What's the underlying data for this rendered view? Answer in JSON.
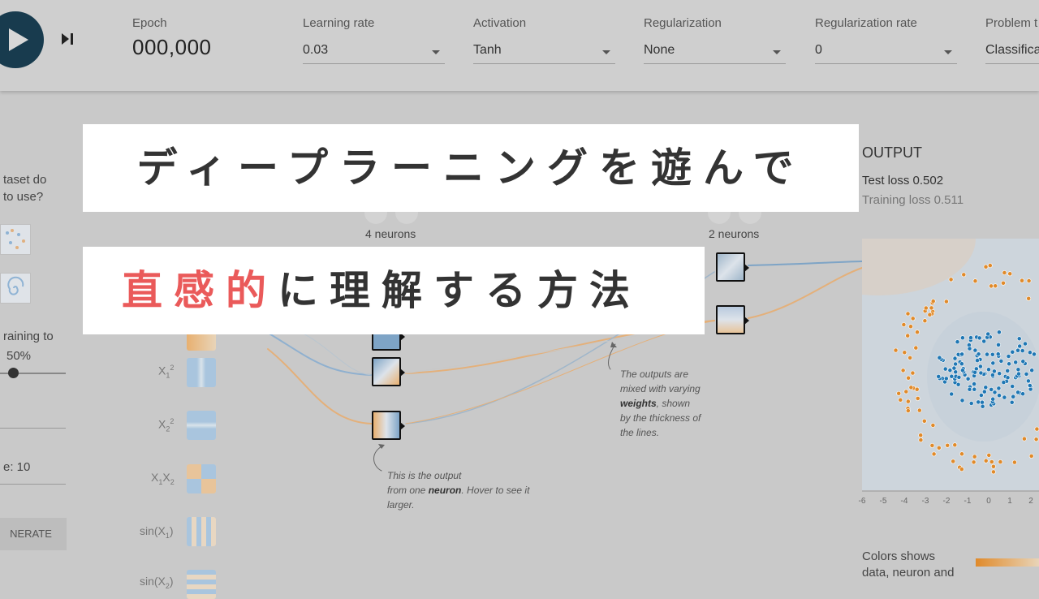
{
  "toolbar": {
    "epoch_label": "Epoch",
    "epoch_value": "000,000",
    "learning_rate_label": "Learning rate",
    "learning_rate_value": "0.03",
    "activation_label": "Activation",
    "activation_value": "Tanh",
    "regularization_label": "Regularization",
    "regularization_value": "None",
    "regularization_rate_label": "Regularization rate",
    "regularization_rate_value": "0",
    "problem_type_label": "Problem t",
    "problem_type_value": "Classifica"
  },
  "data_panel": {
    "question_line1": "taset do",
    "question_line2": "to use?",
    "ratio_label": "raining to",
    "ratio_value": "50%",
    "ratio_level": 0.5,
    "noise_label": "e:  10",
    "regenerate_label": "NERATE"
  },
  "features": {
    "x1sq_base": "X",
    "x1sq_sub": "1",
    "x1sq_sup": "2",
    "x2sq_base": "X",
    "x2sq_sub": "2",
    "x2sq_sup": "2",
    "x1x2_a": "X",
    "x1x2_sub1": "1",
    "x1x2_b": "X",
    "x1x2_sub2": "2",
    "sin_x1_pre": "sin(X",
    "sin_x1_sub": "1",
    "sin_x1_post": ")",
    "sin_x2_pre": "sin(X",
    "sin_x2_sub": "2",
    "sin_x2_post": ")"
  },
  "network": {
    "layer1_count": "4 neurons",
    "layer2_count": "2 neurons",
    "note_neuron_a": "This is the output",
    "note_neuron_b": "from one",
    "note_neuron_bold": "neuron",
    "note_neuron_c": ". Hover to see it",
    "note_neuron_d": "larger.",
    "note_weights_a": "The outputs are",
    "note_weights_b": "mixed with varying",
    "note_weights_bold": "weights",
    "note_weights_c": ", shown",
    "note_weights_d": "by the thickness of",
    "note_weights_e": "the lines."
  },
  "output": {
    "title": "OUTPUT",
    "test_loss": "Test loss 0.502",
    "training_loss": "Training loss 0.511",
    "axis_ticks": [
      "-6",
      "-5",
      "-4",
      "-3",
      "-2",
      "-1",
      "0",
      "1",
      "2"
    ],
    "color_note_line1": "Colors shows",
    "color_note_line2": "data, neuron and"
  },
  "banner": {
    "line1": "ディープラーニングを遊んで",
    "line2_accent": "直感的",
    "line2_rest": "に理解する方法"
  },
  "colors": {
    "positive": "#1f77b4",
    "negative": "#e08a2a",
    "accent": "#ea5a5a"
  }
}
